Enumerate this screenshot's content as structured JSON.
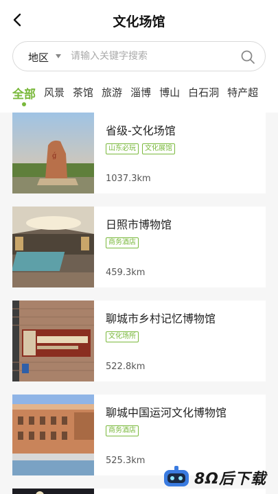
{
  "header": {
    "title": "文化场馆"
  },
  "search": {
    "region_label": "地区",
    "placeholder": "请输入关键字搜索"
  },
  "tabs": [
    {
      "label": "全部",
      "active": true
    },
    {
      "label": "风景",
      "active": false
    },
    {
      "label": "茶馆",
      "active": false
    },
    {
      "label": "旅游",
      "active": false
    },
    {
      "label": "淄博",
      "active": false
    },
    {
      "label": "博山",
      "active": false
    },
    {
      "label": "白石洞",
      "active": false
    },
    {
      "label": "特产超",
      "active": false
    }
  ],
  "items": [
    {
      "title": "省级-文化场馆",
      "tags": [
        "山东必玩",
        "文化展馆"
      ],
      "distance": "1037.3km"
    },
    {
      "title": "日照市博物馆",
      "tags": [
        "商务酒店"
      ],
      "distance": "459.3km"
    },
    {
      "title": "聊城市乡村记忆博物馆",
      "tags": [
        "文化场所"
      ],
      "distance": "522.8km"
    },
    {
      "title": "聊城中国运河文化博物馆",
      "tags": [
        "商务酒店"
      ],
      "distance": "525.3km"
    }
  ],
  "watermark": {
    "text": "8Ω后下载"
  },
  "colors": {
    "accent": "#79b83b",
    "background": "#f6f6f6"
  }
}
